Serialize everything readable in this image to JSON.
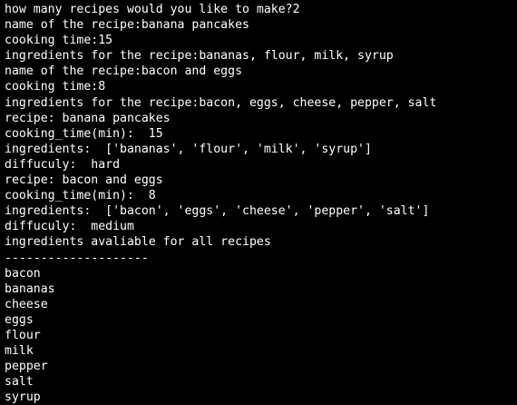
{
  "terminal": {
    "background": "#000000",
    "foreground": "#ffffff",
    "lines": [
      "how many recipes would you like to make?2",
      "name of the recipe:banana pancakes",
      "cooking time:15",
      "ingredients for the recipe:bananas, flour, milk, syrup",
      "name of the recipe:bacon and eggs",
      "cooking time:8",
      "ingredients for the recipe:bacon, eggs, cheese, pepper, salt",
      "recipe: banana pancakes",
      "cooking_time(min):  15",
      "ingredients:  ['bananas', 'flour', 'milk', 'syrup']",
      "diffuculy:  hard",
      "recipe: bacon and eggs",
      "cooking_time(min):  8",
      "ingredients:  ['bacon', 'eggs', 'cheese', 'pepper', 'salt']",
      "diffuculy:  medium",
      "ingredients avaliable for all recipes",
      "--------------------",
      "bacon",
      "bananas",
      "cheese",
      "eggs",
      "flour",
      "milk",
      "pepper",
      "salt",
      "syrup"
    ]
  }
}
